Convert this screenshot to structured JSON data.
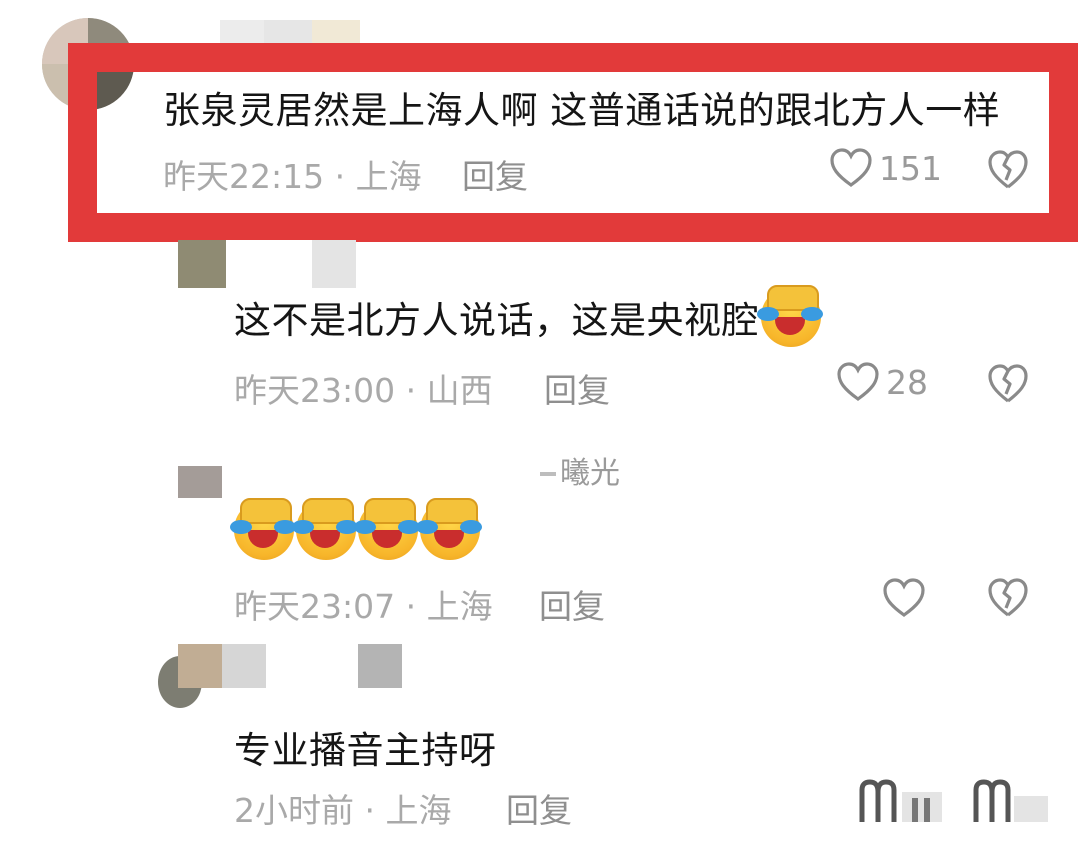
{
  "comments": [
    {
      "text": "张泉灵居然是上海人啊 这普通话说的跟北方人一样",
      "time_loc": "昨天22:15 · 上海",
      "reply": "回复",
      "likes": "151"
    },
    {
      "text": "这不是北方人说话，这是央视腔",
      "time_loc": "昨天23:00 · 山西",
      "reply": "回复",
      "likes": "28"
    },
    {
      "username_partial": "曦光",
      "time_loc": "昨天23:07 · 上海",
      "reply": "回复",
      "likes": ""
    },
    {
      "text": "专业播音主持呀",
      "time_loc": "2小时前 · 上海",
      "reply": "回复",
      "likes": ""
    }
  ],
  "icons": {
    "like": "heart-outline-icon",
    "dislike": "broken-heart-icon",
    "emoji": "facepalm-laughing-emoji"
  },
  "colors": {
    "highlight_border": "#e23a3a",
    "meta_text": "#a9a9a9"
  }
}
